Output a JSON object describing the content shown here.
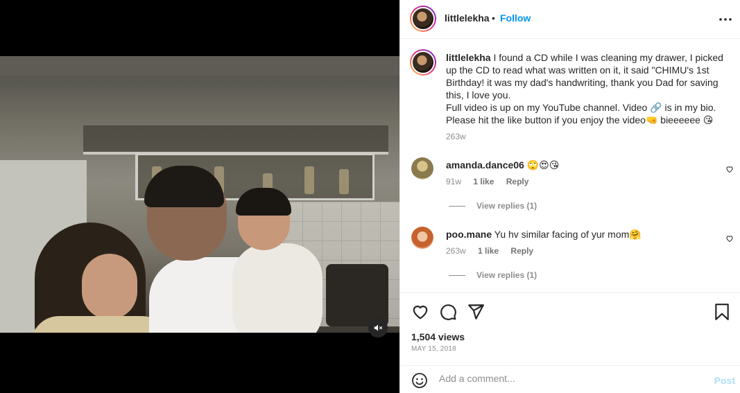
{
  "post": {
    "username": "littlelekha",
    "follow_label": "Follow",
    "separator": "•",
    "caption_lines": [
      "I found a CD while I was cleaning my drawer, I picked up the CD to read what was written on it, it said \"CHIMU's 1st Birthday! it was my dad's handwriting, thank you Dad for saving this, I love you.",
      "Full video is up on my YouTube channel. Video 🔗 is in my bio.",
      "Please hit the like button if you enjoy the video🤜 bieeeeee 😘"
    ],
    "caption_time": "263w",
    "views": "1,504 views",
    "date": "MAY 15, 2018"
  },
  "comments": [
    {
      "username": "amanda.dance06",
      "text": "🙄😍😘",
      "time": "91w",
      "likes": "1 like",
      "reply_label": "Reply",
      "view_replies": "View replies (1)"
    },
    {
      "username": "poo.mane",
      "text": "Yu hv similar facing of yur mom🤗",
      "time": "263w",
      "likes": "1 like",
      "reply_label": "Reply",
      "view_replies": "View replies (1)"
    }
  ],
  "composer": {
    "placeholder": "Add a comment...",
    "post_label": "Post"
  },
  "icons": {
    "more": "more-options-icon",
    "like": "heart-icon",
    "comment": "comment-icon",
    "share": "share-icon",
    "save": "bookmark-icon",
    "mute": "muted-speaker-icon",
    "emoji": "emoji-icon"
  },
  "colors": {
    "accent": "#0095f6",
    "post_disabled": "#b2dffc",
    "muted_text": "#8e8e8e"
  }
}
